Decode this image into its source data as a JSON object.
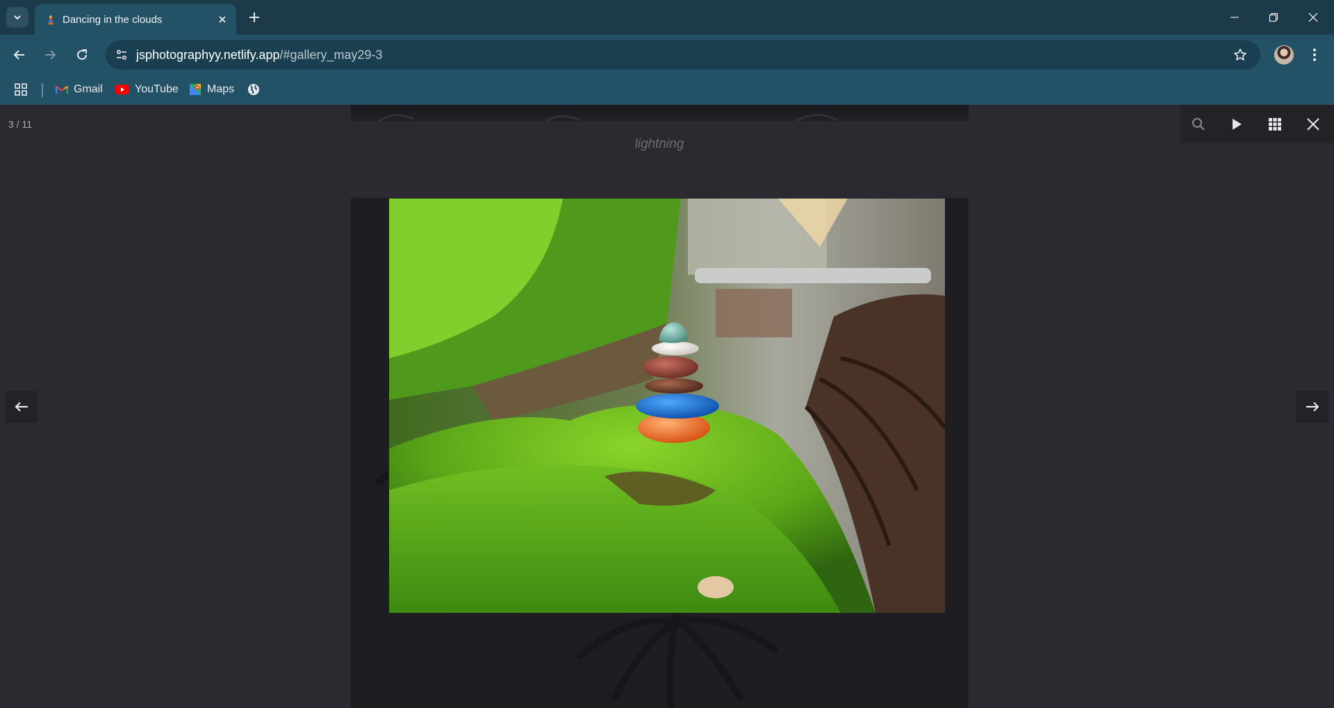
{
  "browser": {
    "tab_title": "Dancing in the clouds",
    "url_host": "jsphotographyy.netlify.app",
    "url_path": "/#gallery_may29-3",
    "bookmarks": [
      {
        "label": "Gmail",
        "icon": "gmail-icon"
      },
      {
        "label": "YouTube",
        "icon": "youtube-icon"
      },
      {
        "label": "Maps",
        "icon": "maps-icon"
      }
    ],
    "colors": {
      "frame": "#1c3a4a",
      "toolbar": "#235266",
      "omnibox": "#1a3f50"
    }
  },
  "lightbox": {
    "counter": "3 / 11",
    "previous_caption": "lightning",
    "current_image": "stacked pebbles on moss",
    "toolbar_icons": [
      "search-icon",
      "play-icon",
      "grid-icon",
      "close-icon"
    ],
    "colors": {
      "background": "#2b2a30",
      "frame": "#1e1d22"
    }
  }
}
